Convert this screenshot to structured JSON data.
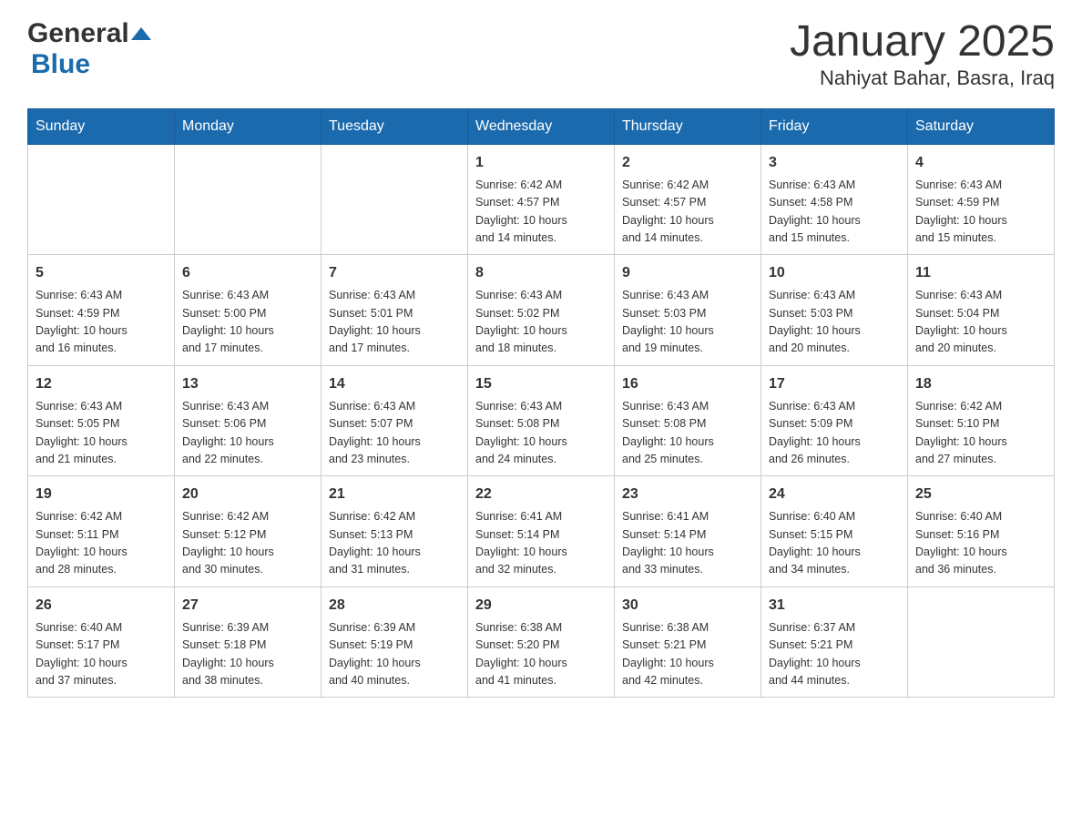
{
  "header": {
    "logo_general": "General",
    "logo_blue": "Blue",
    "month_title": "January 2025",
    "location": "Nahiyat Bahar, Basra, Iraq"
  },
  "weekdays": [
    "Sunday",
    "Monday",
    "Tuesday",
    "Wednesday",
    "Thursday",
    "Friday",
    "Saturday"
  ],
  "weeks": [
    {
      "days": [
        {
          "number": "",
          "info": ""
        },
        {
          "number": "",
          "info": ""
        },
        {
          "number": "",
          "info": ""
        },
        {
          "number": "1",
          "info": "Sunrise: 6:42 AM\nSunset: 4:57 PM\nDaylight: 10 hours\nand 14 minutes."
        },
        {
          "number": "2",
          "info": "Sunrise: 6:42 AM\nSunset: 4:57 PM\nDaylight: 10 hours\nand 14 minutes."
        },
        {
          "number": "3",
          "info": "Sunrise: 6:43 AM\nSunset: 4:58 PM\nDaylight: 10 hours\nand 15 minutes."
        },
        {
          "number": "4",
          "info": "Sunrise: 6:43 AM\nSunset: 4:59 PM\nDaylight: 10 hours\nand 15 minutes."
        }
      ]
    },
    {
      "days": [
        {
          "number": "5",
          "info": "Sunrise: 6:43 AM\nSunset: 4:59 PM\nDaylight: 10 hours\nand 16 minutes."
        },
        {
          "number": "6",
          "info": "Sunrise: 6:43 AM\nSunset: 5:00 PM\nDaylight: 10 hours\nand 17 minutes."
        },
        {
          "number": "7",
          "info": "Sunrise: 6:43 AM\nSunset: 5:01 PM\nDaylight: 10 hours\nand 17 minutes."
        },
        {
          "number": "8",
          "info": "Sunrise: 6:43 AM\nSunset: 5:02 PM\nDaylight: 10 hours\nand 18 minutes."
        },
        {
          "number": "9",
          "info": "Sunrise: 6:43 AM\nSunset: 5:03 PM\nDaylight: 10 hours\nand 19 minutes."
        },
        {
          "number": "10",
          "info": "Sunrise: 6:43 AM\nSunset: 5:03 PM\nDaylight: 10 hours\nand 20 minutes."
        },
        {
          "number": "11",
          "info": "Sunrise: 6:43 AM\nSunset: 5:04 PM\nDaylight: 10 hours\nand 20 minutes."
        }
      ]
    },
    {
      "days": [
        {
          "number": "12",
          "info": "Sunrise: 6:43 AM\nSunset: 5:05 PM\nDaylight: 10 hours\nand 21 minutes."
        },
        {
          "number": "13",
          "info": "Sunrise: 6:43 AM\nSunset: 5:06 PM\nDaylight: 10 hours\nand 22 minutes."
        },
        {
          "number": "14",
          "info": "Sunrise: 6:43 AM\nSunset: 5:07 PM\nDaylight: 10 hours\nand 23 minutes."
        },
        {
          "number": "15",
          "info": "Sunrise: 6:43 AM\nSunset: 5:08 PM\nDaylight: 10 hours\nand 24 minutes."
        },
        {
          "number": "16",
          "info": "Sunrise: 6:43 AM\nSunset: 5:08 PM\nDaylight: 10 hours\nand 25 minutes."
        },
        {
          "number": "17",
          "info": "Sunrise: 6:43 AM\nSunset: 5:09 PM\nDaylight: 10 hours\nand 26 minutes."
        },
        {
          "number": "18",
          "info": "Sunrise: 6:42 AM\nSunset: 5:10 PM\nDaylight: 10 hours\nand 27 minutes."
        }
      ]
    },
    {
      "days": [
        {
          "number": "19",
          "info": "Sunrise: 6:42 AM\nSunset: 5:11 PM\nDaylight: 10 hours\nand 28 minutes."
        },
        {
          "number": "20",
          "info": "Sunrise: 6:42 AM\nSunset: 5:12 PM\nDaylight: 10 hours\nand 30 minutes."
        },
        {
          "number": "21",
          "info": "Sunrise: 6:42 AM\nSunset: 5:13 PM\nDaylight: 10 hours\nand 31 minutes."
        },
        {
          "number": "22",
          "info": "Sunrise: 6:41 AM\nSunset: 5:14 PM\nDaylight: 10 hours\nand 32 minutes."
        },
        {
          "number": "23",
          "info": "Sunrise: 6:41 AM\nSunset: 5:14 PM\nDaylight: 10 hours\nand 33 minutes."
        },
        {
          "number": "24",
          "info": "Sunrise: 6:40 AM\nSunset: 5:15 PM\nDaylight: 10 hours\nand 34 minutes."
        },
        {
          "number": "25",
          "info": "Sunrise: 6:40 AM\nSunset: 5:16 PM\nDaylight: 10 hours\nand 36 minutes."
        }
      ]
    },
    {
      "days": [
        {
          "number": "26",
          "info": "Sunrise: 6:40 AM\nSunset: 5:17 PM\nDaylight: 10 hours\nand 37 minutes."
        },
        {
          "number": "27",
          "info": "Sunrise: 6:39 AM\nSunset: 5:18 PM\nDaylight: 10 hours\nand 38 minutes."
        },
        {
          "number": "28",
          "info": "Sunrise: 6:39 AM\nSunset: 5:19 PM\nDaylight: 10 hours\nand 40 minutes."
        },
        {
          "number": "29",
          "info": "Sunrise: 6:38 AM\nSunset: 5:20 PM\nDaylight: 10 hours\nand 41 minutes."
        },
        {
          "number": "30",
          "info": "Sunrise: 6:38 AM\nSunset: 5:21 PM\nDaylight: 10 hours\nand 42 minutes."
        },
        {
          "number": "31",
          "info": "Sunrise: 6:37 AM\nSunset: 5:21 PM\nDaylight: 10 hours\nand 44 minutes."
        },
        {
          "number": "",
          "info": ""
        }
      ]
    }
  ]
}
